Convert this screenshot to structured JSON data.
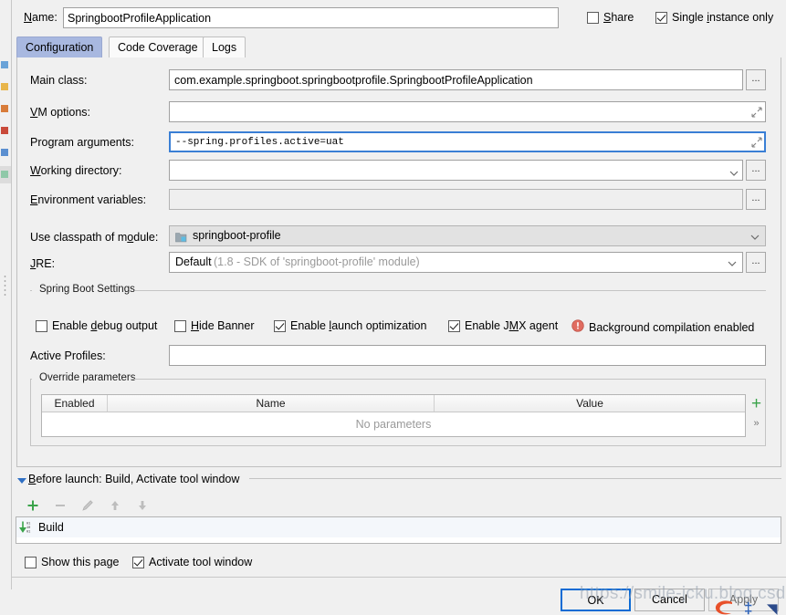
{
  "window": {
    "name_label": "Name:",
    "name_value": "SpringbootProfileApplication",
    "share_label": "Share",
    "single_instance_label": "Single instance only"
  },
  "tabs": [
    {
      "label": "Configuration",
      "active": true
    },
    {
      "label": "Code Coverage",
      "active": false
    },
    {
      "label": "Logs",
      "active": false
    }
  ],
  "fields": {
    "main_class": {
      "label": "Main class:",
      "value": "com.example.springboot.springbootprofile.SpringbootProfileApplication",
      "browse": "..."
    },
    "vm_options": {
      "label": "VM options:",
      "value": ""
    },
    "program_arguments": {
      "label": "Program arguments:",
      "value": "--spring.profiles.active=uat"
    },
    "working_directory": {
      "label": "Working directory:",
      "value": "",
      "browse": "..."
    },
    "environment_variables": {
      "label": "Environment variables:",
      "value": "",
      "browse": "..."
    },
    "use_classpath_of_module": {
      "label": "Use classpath of module:",
      "value": "springboot-profile"
    },
    "jre": {
      "label": "JRE:",
      "value": "Default",
      "value_hint": "(1.8 - SDK of 'springboot-profile' module)",
      "browse": "..."
    }
  },
  "spring_boot_settings": {
    "title": "Spring Boot Settings",
    "checkboxes": [
      {
        "label": "Enable debug output",
        "checked": false
      },
      {
        "label": "Hide Banner",
        "checked": false
      },
      {
        "label": "Enable launch optimization",
        "checked": true
      },
      {
        "label": "Enable JMX agent",
        "checked": true
      }
    ],
    "warning_text": "Background compilation enabled",
    "active_profiles_label": "Active Profiles:",
    "active_profiles_value": ""
  },
  "override_parameters": {
    "title": "Override parameters",
    "columns": [
      "Enabled",
      "Name",
      "Value"
    ],
    "empty_text": "No parameters",
    "add_button": "+",
    "more_button": "»"
  },
  "before_launch": {
    "title": "Before launch: Build, Activate tool window",
    "toolbar": [
      "add",
      "remove",
      "edit",
      "move-up",
      "move-down"
    ],
    "items": [
      {
        "label": "Build"
      }
    ]
  },
  "footer": {
    "show_page_label": "Show this page",
    "show_page_checked": false,
    "activate_tool_window_label": "Activate tool window",
    "activate_tool_window_checked": true,
    "buttons": [
      {
        "label": "OK",
        "state": "default"
      },
      {
        "label": "Cancel",
        "state": "normal"
      },
      {
        "label": "Apply",
        "state": "disabled"
      }
    ]
  },
  "watermark": {
    "text": "https://smile-jcku.blog.csdn.net"
  },
  "colors": {
    "accent": "#0d6bd4",
    "tab_active": "#a8b8e0",
    "warning": "#e06c60",
    "add_green": "#3aa34a"
  }
}
